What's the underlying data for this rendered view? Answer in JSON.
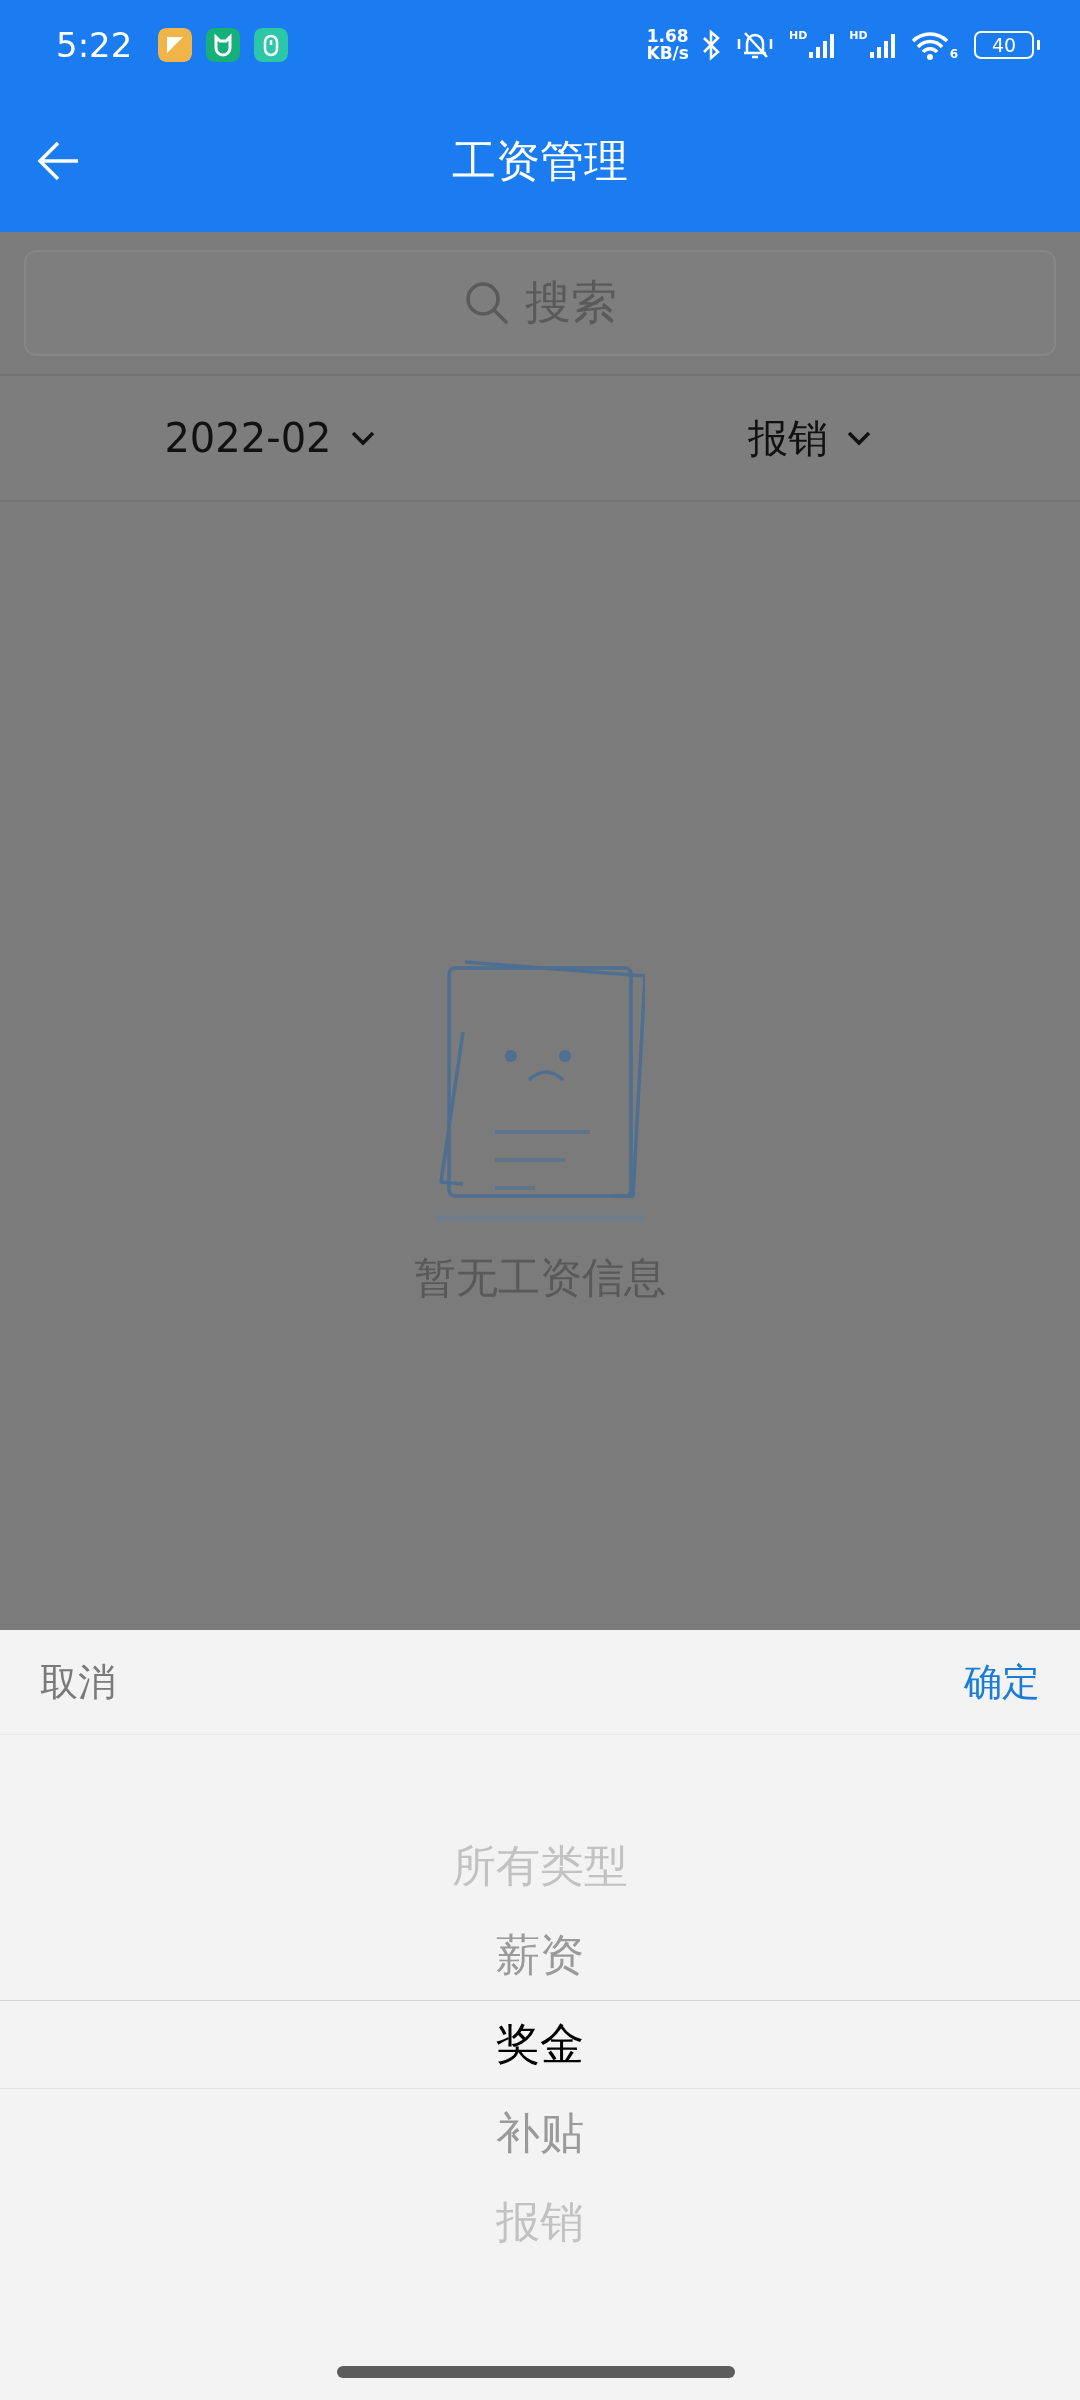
{
  "status_bar": {
    "time": "5:22",
    "net_speed": {
      "value": "1.68",
      "unit": "KB/s"
    },
    "signal_labels": [
      "HD",
      "HD"
    ],
    "wifi_label": "6",
    "battery": "40"
  },
  "app_bar": {
    "title": "工资管理"
  },
  "search": {
    "placeholder": "搜索"
  },
  "filters": [
    {
      "label": "2022-02"
    },
    {
      "label": "报销"
    }
  ],
  "empty_state": {
    "message": "暂无工资信息"
  },
  "picker": {
    "cancel": "取消",
    "confirm": "确定",
    "options": [
      {
        "label": "所有类型",
        "selected": false
      },
      {
        "label": "薪资",
        "selected": false
      },
      {
        "label": "奖金",
        "selected": true
      },
      {
        "label": "补贴",
        "selected": false
      },
      {
        "label": "报销",
        "selected": false
      }
    ]
  }
}
